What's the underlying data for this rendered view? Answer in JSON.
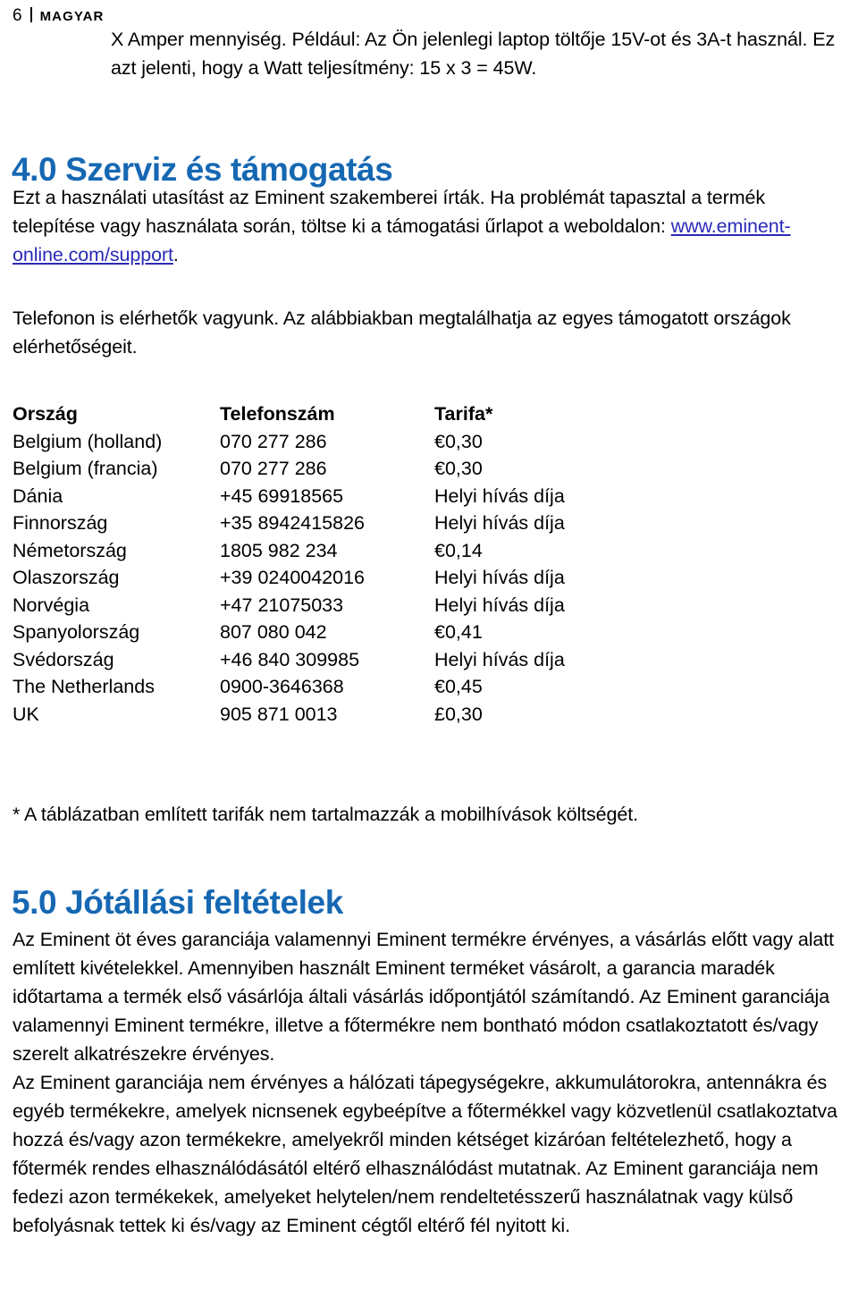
{
  "header": {
    "page_number": "6",
    "separator": "|",
    "language": "MAGYAR"
  },
  "intro": {
    "text": "X Amper mennyiség. Például: Az Ön jelenlegi laptop töltője 15V-ot és 3A-t használ. Ez azt jelenti, hogy a Watt teljesítmény: 15 x 3 = 45W."
  },
  "section_service": {
    "heading": "4.0 Szerviz és támogatás",
    "paragraph_before_link": "Ezt a használati utasítást az Eminent szakemberei írták. Ha problémát tapasztal a termék telepítése vagy használata során, töltse ki a támogatási űrlapot a weboldalon: ",
    "link_text": "www.eminent-online.com/support",
    "paragraph_after_link": ".",
    "phone_paragraph": "Telefonon is elérhetők vagyunk. Az alábbiakban megtalálhatja az egyes támogatott országok elérhetőségeit."
  },
  "tariff_table": {
    "columns": [
      "Ország",
      "Telefonszám",
      "Tarifa*"
    ],
    "rows": [
      {
        "country": "Belgium (holland)",
        "phone": "070 277 286",
        "tariff": "€0,30"
      },
      {
        "country": "Belgium (francia)",
        "phone": "070 277 286",
        "tariff": "€0,30"
      },
      {
        "country": "Dánia",
        "phone": "+45 69918565",
        "tariff": "Helyi hívás díja"
      },
      {
        "country": "Finnország",
        "phone": "+35 8942415826",
        "tariff": "Helyi hívás díja"
      },
      {
        "country": "Németország",
        "phone": "1805 982 234",
        "tariff": "€0,14"
      },
      {
        "country": "Olaszország",
        "phone": "+39 0240042016",
        "tariff": "Helyi hívás díja"
      },
      {
        "country": "Norvégia",
        "phone": "+47 21075033",
        "tariff": "Helyi hívás díja"
      },
      {
        "country": "Spanyolország",
        "phone": "807 080 042",
        "tariff": "€0,41"
      },
      {
        "country": "Svédország",
        "phone": "+46 840 309985",
        "tariff": "Helyi hívás díja"
      },
      {
        "country": "The Netherlands",
        "phone": "0900-3646368",
        "tariff": "€0,45"
      },
      {
        "country": "UK",
        "phone": "905 871 0013",
        "tariff": "£0,30"
      }
    ],
    "footnote": "* A táblázatban említett tarifák nem tartalmazzák a mobilhívások költségét."
  },
  "section_warranty": {
    "heading": "5.0 Jótállási feltételek",
    "paragraphs": [
      "Az Eminent öt éves garanciája valamennyi Eminent termékre érvényes, a vásárlás előtt vagy alatt említett kivételekkel. Amennyiben használt Eminent terméket vásárolt, a garancia maradék időtartama a termék első vásárlója általi vásárlás időpontjától számítandó. Az Eminent garanciája valamennyi Eminent termékre, illetve a főtermékre nem bontható módon csatlakoztatott és/vagy szerelt alkatrészekre érvényes.",
      "Az Eminent garanciája nem érvényes a hálózati tápegységekre, akkumulátorokra, antennákra és egyéb termékekre, amelyek nicnsenek egybeépítve a főtermékkel vagy közvetlenül csatlakoztatva hozzá és/vagy azon termékekre, amelyekről minden kétséget kizáróan feltételezhető, hogy a főtermék rendes elhasználódásától eltérő elhasználódást mutatnak. Az Eminent garanciája nem fedezi azon termékekek, amelyeket helytelen/nem rendeltetésszerű használatnak vagy külső befolyásnak tettek ki és/vagy az Eminent cégtől eltérő fél nyitott ki."
    ]
  },
  "colors": {
    "heading_blue": "#1668b3",
    "link_blue": "#2a2ab8",
    "text_black": "#000000",
    "page_background": "#ffffff"
  }
}
